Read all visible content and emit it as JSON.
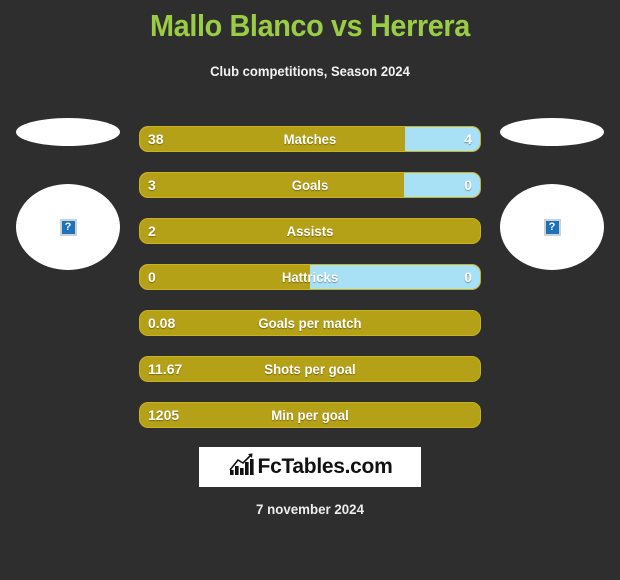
{
  "header": {
    "title": "Mallo Blanco vs Herrera",
    "subtitle": "Club competitions, Season 2024",
    "title_color": "#9ACD45"
  },
  "theme": {
    "background": "#2E2E2E",
    "bar_home_color": "#B5A117",
    "bar_away_color": "#A8E0F5",
    "bar_border_color": "#C9B420",
    "text_color": "#FFFFFF"
  },
  "crests": {
    "home": {
      "icon": "broken-image-icon",
      "glyph": "?"
    },
    "away": {
      "icon": "broken-image-icon",
      "glyph": "?"
    }
  },
  "stats": [
    {
      "label": "Matches",
      "home": "38",
      "away": "4",
      "home_pct": 78.0,
      "show_away": true
    },
    {
      "label": "Goals",
      "home": "3",
      "away": "0",
      "home_pct": 77.5,
      "show_away": true
    },
    {
      "label": "Assists",
      "home": "2",
      "away": "",
      "home_pct": 100.0,
      "show_away": false
    },
    {
      "label": "Hattricks",
      "home": "0",
      "away": "0",
      "home_pct": 50.0,
      "show_away": true
    },
    {
      "label": "Goals per match",
      "home": "0.08",
      "away": "",
      "home_pct": 100.0,
      "show_away": false
    },
    {
      "label": "Shots per goal",
      "home": "11.67",
      "away": "",
      "home_pct": 100.0,
      "show_away": false
    },
    {
      "label": "Min per goal",
      "home": "1205",
      "away": "",
      "home_pct": 100.0,
      "show_away": false
    }
  ],
  "footer": {
    "logo_text": "FcTables.com",
    "logo_icon": "bar-chart-growth-icon",
    "date": "7 november 2024"
  },
  "chart_data": {
    "type": "bar",
    "title": "Mallo Blanco vs Herrera",
    "subtitle": "Club competitions, Season 2024",
    "categories": [
      "Matches",
      "Goals",
      "Assists",
      "Hattricks",
      "Goals per match",
      "Shots per goal",
      "Min per goal"
    ],
    "series": [
      {
        "name": "Mallo Blanco",
        "values": [
          38,
          3,
          2,
          0,
          0.08,
          11.67,
          1205
        ]
      },
      {
        "name": "Herrera",
        "values": [
          4,
          0,
          null,
          0,
          null,
          null,
          null
        ]
      }
    ],
    "xlabel": "",
    "ylabel": "",
    "legend": [
      "Mallo Blanco",
      "Herrera"
    ],
    "grid": false,
    "annotations": [
      "7 november 2024"
    ]
  }
}
